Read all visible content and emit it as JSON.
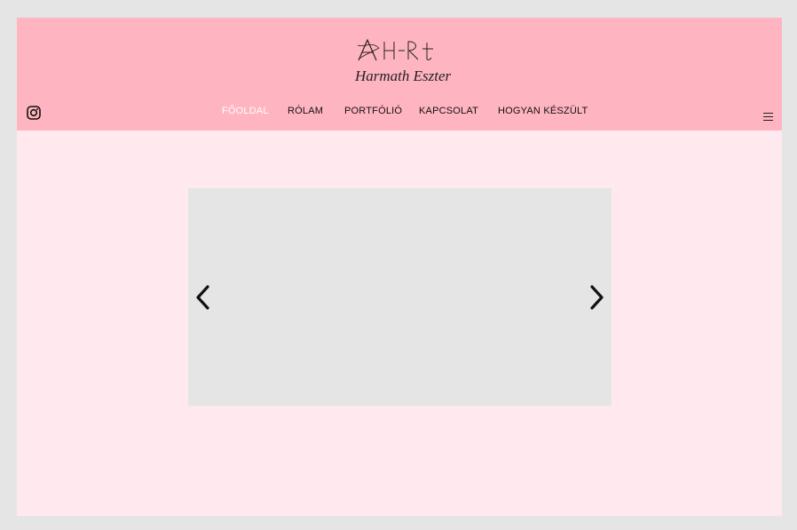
{
  "header": {
    "logo_mark": "AH-Rt",
    "logo_subtitle": "Harmath Eszter",
    "background_color": "#ffb4c1"
  },
  "nav": {
    "items": [
      {
        "label": "FŐOLDAL",
        "active": true
      },
      {
        "label": "RÓLAM",
        "active": false
      },
      {
        "label": "PORTFÓLIÓ",
        "active": false
      },
      {
        "label": "KAPCSOLAT",
        "active": false
      },
      {
        "label": "HOGYAN KÉSZÜLT",
        "active": false
      }
    ]
  },
  "icons": {
    "social": "instagram-icon",
    "menu": "hamburger-icon",
    "prev": "chevron-left-icon",
    "next": "chevron-right-icon"
  },
  "colors": {
    "page_background": "#ffe9ee",
    "outer_background": "#e5e5e5",
    "slider_background": "#e5e5e5",
    "active_nav": "#ffffff"
  }
}
